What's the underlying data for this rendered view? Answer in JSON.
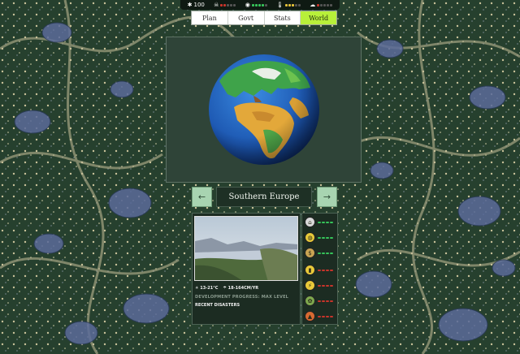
{
  "status_bar": {
    "stats": [
      {
        "icon": "sparkle-icon",
        "glyph": "✱",
        "value": "100",
        "level": null,
        "color": null
      },
      {
        "icon": "skull-icon",
        "glyph": "☠",
        "value": "",
        "level": 2,
        "color": "#c8342b"
      },
      {
        "icon": "health-icon",
        "glyph": "◉",
        "value": "",
        "level": 4,
        "color": "#36c45a"
      },
      {
        "icon": "thermometer-icon",
        "glyph": "🌡",
        "value": "",
        "level": 3,
        "color": "#e6c23a"
      },
      {
        "icon": "cloud-icon",
        "glyph": "☁",
        "value": "",
        "level": 1,
        "color": "#c8342b"
      }
    ]
  },
  "tabs": [
    {
      "label": "Plan",
      "active": false
    },
    {
      "label": "Govt",
      "active": false
    },
    {
      "label": "Stats",
      "active": false
    },
    {
      "label": "World",
      "active": true
    }
  ],
  "region": {
    "prev_icon": "←",
    "next_icon": "→",
    "name": "Southern Europe",
    "temperature": "13-21°C",
    "precipitation": "18-164CM/YR",
    "development": "DEVELOPMENT PROGRESS: MAX LEVEL",
    "disasters_label": "RECENT DISASTERS"
  },
  "indicators": [
    {
      "icon": "housing-icon",
      "glyph": "⌂",
      "color": "#36c45a",
      "bg": "#d9d9d9"
    },
    {
      "icon": "food-icon",
      "glyph": "◍",
      "color": "#36c45a",
      "bg": "#e8c93a"
    },
    {
      "icon": "money-icon",
      "glyph": "$",
      "color": "#36c45a",
      "bg": "#c9a453"
    },
    {
      "icon": "fuel-icon",
      "glyph": "▮",
      "color": "#c8342b",
      "bg": "#e8c93a"
    },
    {
      "icon": "electricity-icon",
      "glyph": "⚡",
      "color": "#c8342b",
      "bg": "#e8c93a"
    },
    {
      "icon": "plant-icon",
      "glyph": "✿",
      "color": "#c8342b",
      "bg": "#7ea84e"
    },
    {
      "icon": "industry-icon",
      "glyph": "▲",
      "color": "#c8342b",
      "bg": "#d86a32"
    }
  ],
  "colors": {
    "accent_tab": "#b8f03a",
    "nav_button": "#a8d4b1",
    "good": "#36c45a",
    "bad": "#c8342b"
  }
}
